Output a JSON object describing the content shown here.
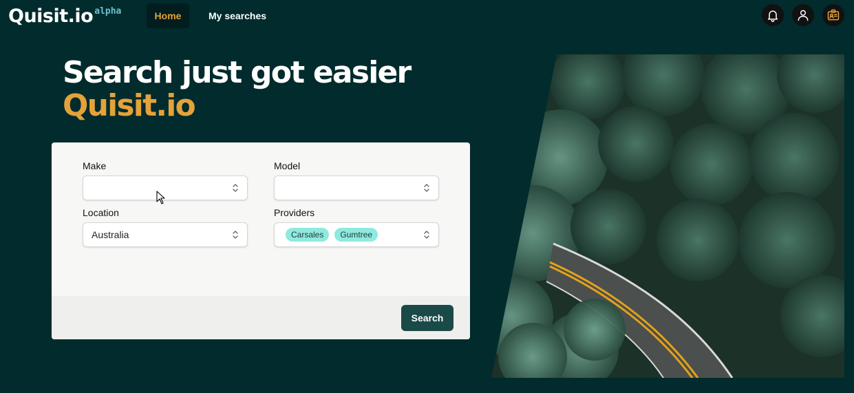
{
  "nav": {
    "logo_text": "Quisit.io",
    "logo_tag": "alpha",
    "home_label": "Home",
    "searches_label": "My searches",
    "icons": [
      "bell-icon",
      "user-icon",
      "id-card-icon"
    ]
  },
  "hero": {
    "line1": "Search just got easier",
    "line2": "Quisit.io"
  },
  "form": {
    "make_label": "Make",
    "make_value": "",
    "model_label": "Model",
    "model_value": "",
    "location_label": "Location",
    "location_value": "Australia",
    "providers_label": "Providers",
    "providers": [
      "Carsales",
      "Gumtree"
    ],
    "search_label": "Search"
  },
  "colors": {
    "background": "#012b2c",
    "accent": "#e4a23a",
    "chip": "#8fe9de",
    "button": "#1a4a47"
  }
}
